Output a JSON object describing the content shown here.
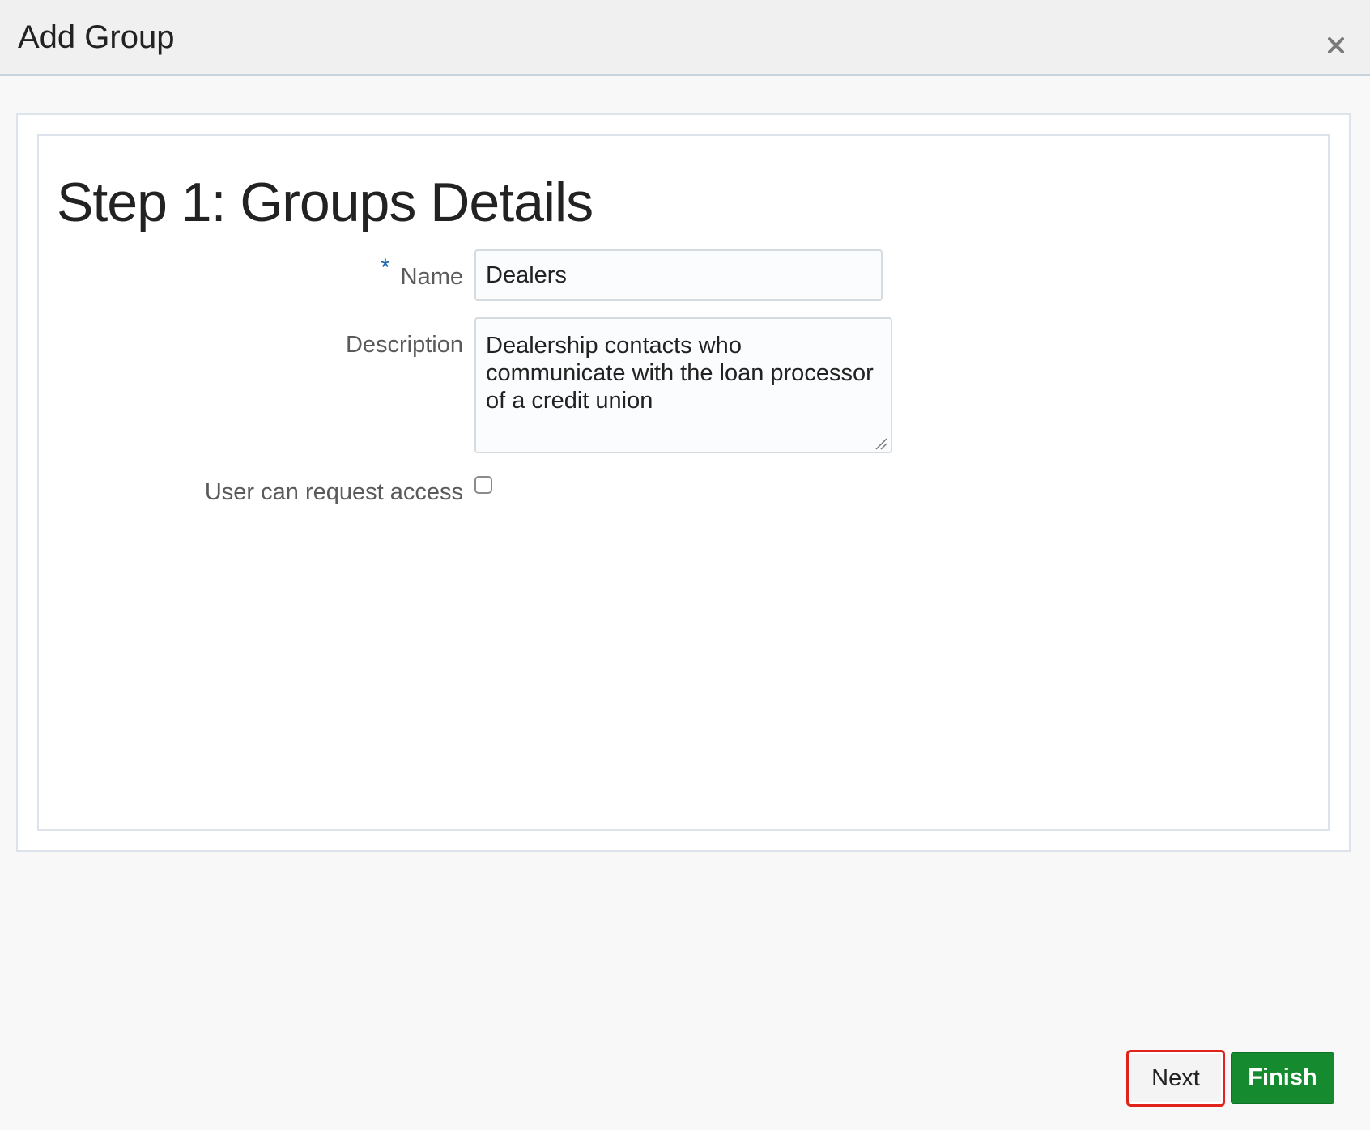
{
  "dialog": {
    "title": "Add Group",
    "close_icon": "close-icon"
  },
  "step": {
    "title": "Step 1: Groups Details"
  },
  "form": {
    "name": {
      "label": "Name",
      "required_marker": "*",
      "value": "Dealers"
    },
    "description": {
      "label": "Description",
      "value": "Dealership contacts who communicate with the loan processor of a credit union"
    },
    "request_access": {
      "label": "User can request access",
      "checked": false
    }
  },
  "footer": {
    "next_label": "Next",
    "finish_label": "Finish"
  },
  "colors": {
    "finish_button": "#158a2f",
    "highlight_outline": "#e0241b",
    "required_star": "#1a66b3"
  }
}
